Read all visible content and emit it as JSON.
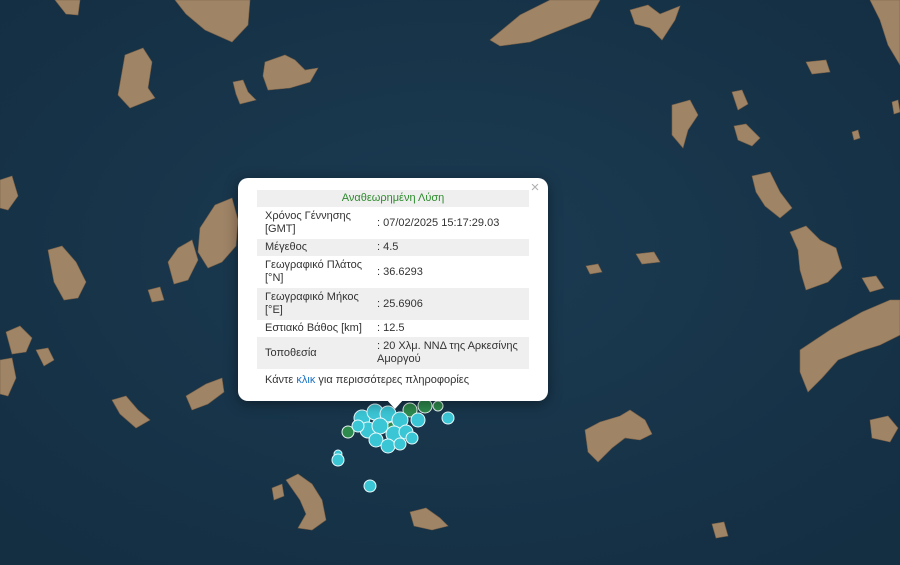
{
  "map": {
    "colors": {
      "sea": "#17344a",
      "land": "#a08466",
      "quake_recent": "#3bc6d6",
      "quake_old": "#2e8b4e"
    }
  },
  "popup": {
    "title": "Αναθεωρημένη Λύση",
    "close_icon": "×",
    "rows": [
      {
        "label": "Χρόνος Γέννησης [GMT]",
        "value": ": 07/02/2025 15:17:29.03"
      },
      {
        "label": "Μέγεθος",
        "value": ": 4.5"
      },
      {
        "label": "Γεωγραφικό Πλάτος [°N]",
        "value": ": 36.6293"
      },
      {
        "label": "Γεωγραφικό Μήκος [°E]",
        "value": ": 25.6906"
      },
      {
        "label": "Εστιακό Βάθος [km]",
        "value": ": 12.5"
      },
      {
        "label": "Τοποθεσία",
        "value": ": 20 Χλμ. ΝΝΔ της Αρκεσίνης Αμοργού"
      }
    ],
    "more_prefix": "Κάντε",
    "more_link": "κλικ",
    "more_suffix": "για περισσότερες πληροφορίες"
  }
}
